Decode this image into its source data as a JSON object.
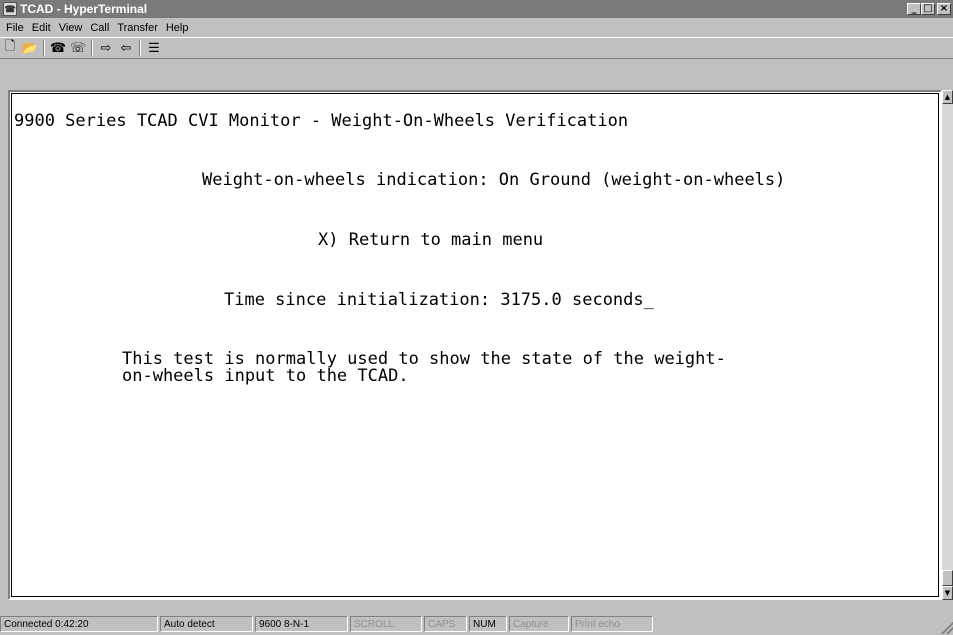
{
  "window": {
    "title": "TCAD - HyperTerminal"
  },
  "menu": [
    {
      "label": "File"
    },
    {
      "label": "Edit"
    },
    {
      "label": "View"
    },
    {
      "label": "Call"
    },
    {
      "label": "Transfer"
    },
    {
      "label": "Help"
    }
  ],
  "toolbar": {
    "icons": [
      "new-icon",
      "open-icon",
      "dial-icon",
      "disconnect-icon",
      "send-icon",
      "receive-icon",
      "properties-icon"
    ]
  },
  "terminal": {
    "line1": "9900 Series TCAD CVI Monitor - Weight-On-Wheels Verification",
    "line2": "Weight-on-wheels indication: On Ground (weight-on-wheels)",
    "line3": "X) Return to main menu",
    "line4": "Time since initialization: 3175.0 seconds_",
    "line5": "This test is normally used to show the state of the weight-",
    "line6": "on-wheels input to the TCAD."
  },
  "status": {
    "connected": "Connected 0:42:20",
    "detect": "Auto detect",
    "port": "9600 8-N-1",
    "scroll": "SCROLL",
    "caps": "CAPS",
    "num": "NUM",
    "capture": "Capture",
    "print_echo": "Print echo"
  }
}
